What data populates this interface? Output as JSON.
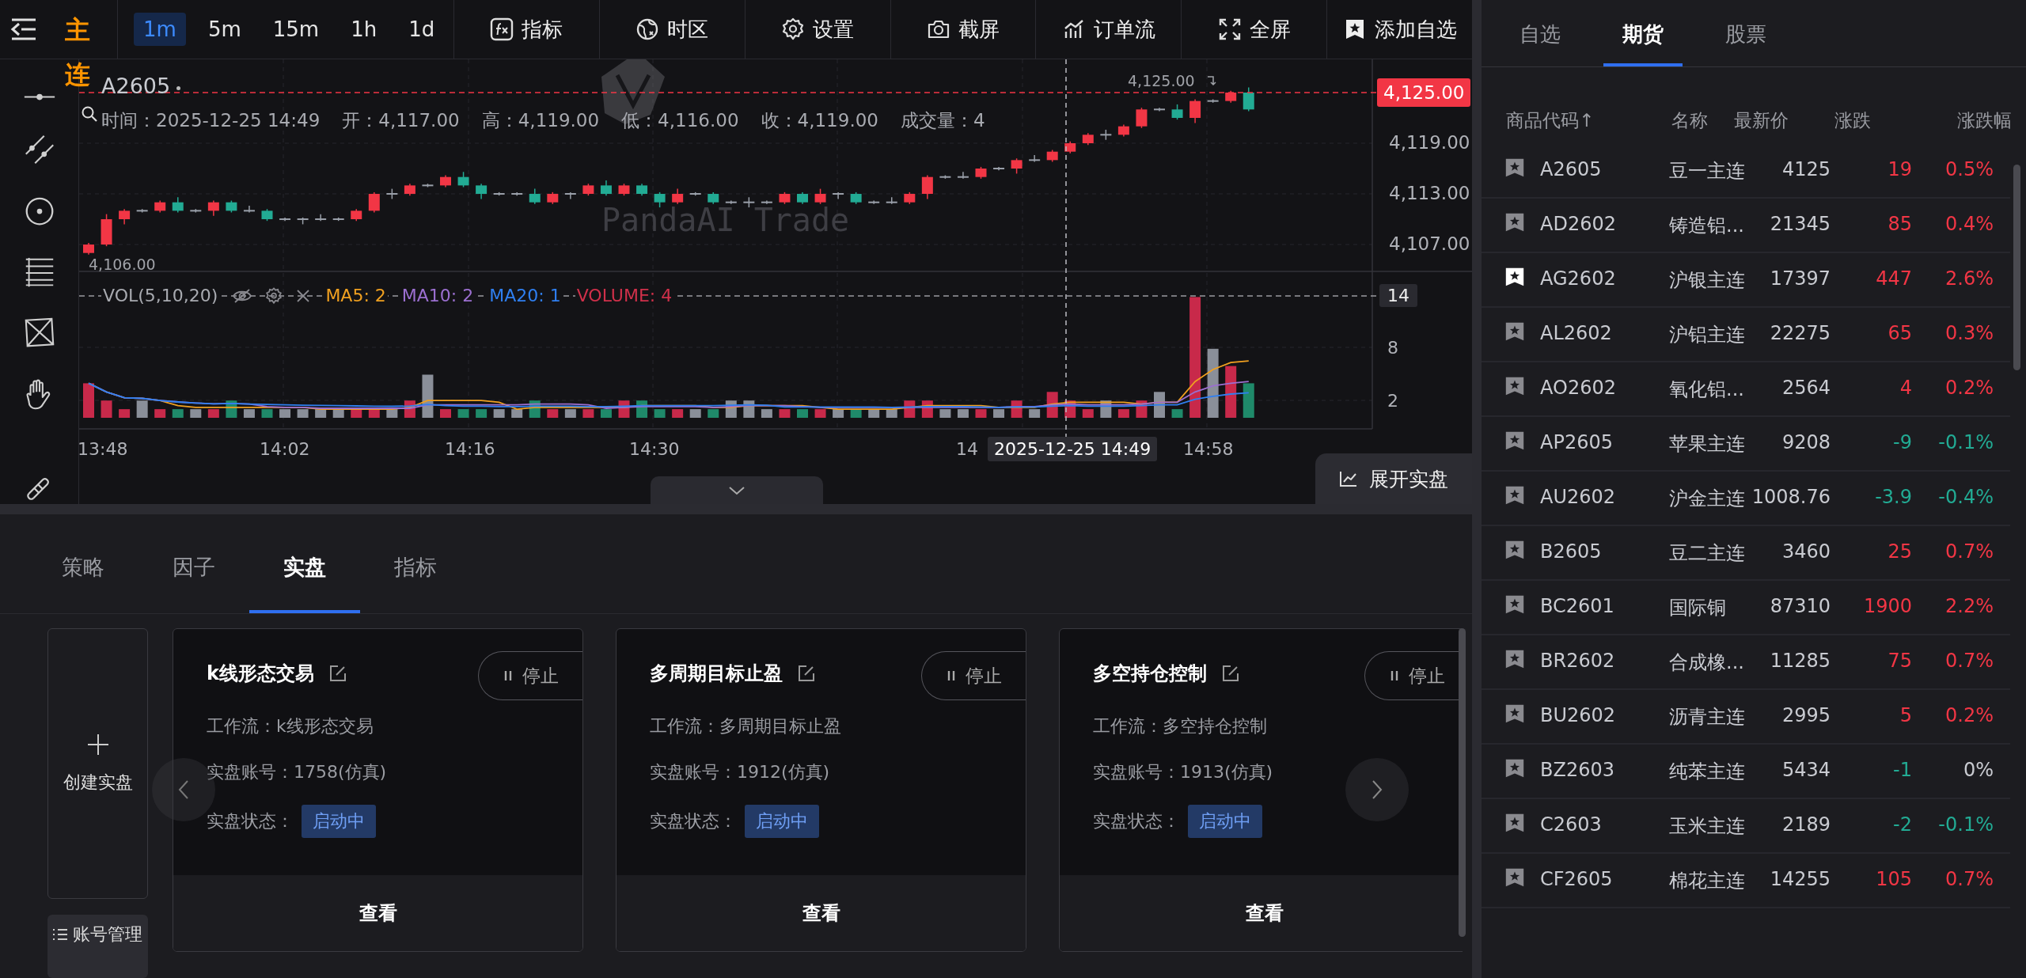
{
  "contract_badge": "主连",
  "intervals": [
    {
      "label": "1m",
      "selected": true
    },
    {
      "label": "5m",
      "selected": false
    },
    {
      "label": "15m",
      "selected": false
    },
    {
      "label": "1h",
      "selected": false
    },
    {
      "label": "1d",
      "selected": false
    }
  ],
  "toolbar_buttons": [
    {
      "label": "指标"
    },
    {
      "label": "时区"
    },
    {
      "label": "设置"
    },
    {
      "label": "截屏"
    },
    {
      "label": "订单流"
    },
    {
      "label": "全屏"
    },
    {
      "label": "添加自选"
    }
  ],
  "chart": {
    "symbol": "A2605",
    "info": [
      "时间：2025-12-25 14:49",
      "开：4,117.00",
      "高：4,119.00",
      "低：4,116.00",
      "收：4,119.00",
      "成交量：4"
    ],
    "price_ticks": [
      "4,119.00",
      "4,113.00",
      "4,107.00"
    ],
    "current_price": "4,125.00",
    "high_mark": "4,125.00",
    "low_mark": "4,106.00",
    "watermark": "PandaAI Trade",
    "volume_title": "VOL(5,10,20)",
    "volume_legend": [
      {
        "text": "MA5: 2",
        "color": "#f0a020"
      },
      {
        "text": "MA10: 2",
        "color": "#9b6fd0"
      },
      {
        "text": "MA20: 1",
        "color": "#2f7ff0"
      },
      {
        "text": "VOLUME: 4",
        "color": "#d0304a"
      }
    ],
    "volume_tag": "14",
    "volume_ticks": [
      "8",
      "2"
    ],
    "time_ticks": [
      "13:48",
      "14:02",
      "14:16",
      "14:30",
      "14",
      "14:58"
    ],
    "crosshair_time": "2025-12-25 14:49"
  },
  "expand_button": "展开实盘",
  "bottom_tabs": [
    {
      "label": "策略",
      "selected": false
    },
    {
      "label": "因子",
      "selected": false
    },
    {
      "label": "实盘",
      "selected": true
    },
    {
      "label": "指标",
      "selected": false
    }
  ],
  "create_card": "创建实盘",
  "account_button": "账号管理",
  "cards": [
    {
      "title": "k线形态交易",
      "stop": "停止",
      "workflow": "工作流：k线形态交易",
      "account": "实盘账号：1758(仿真)",
      "status_label": "实盘状态：",
      "status": "启动中",
      "view": "查看"
    },
    {
      "title": "多周期目标止盈",
      "stop": "停止",
      "workflow": "工作流：多周期目标止盈",
      "account": "实盘账号：1912(仿真)",
      "status_label": "实盘状态：",
      "status": "启动中",
      "view": "查看"
    },
    {
      "title": "多空持仓控制",
      "stop": "停止",
      "workflow": "工作流：多空持仓控制",
      "account": "实盘账号：1913(仿真)",
      "status_label": "实盘状态：",
      "status": "启动中",
      "view": "查看"
    }
  ],
  "side_tabs": [
    {
      "label": "自选",
      "selected": false
    },
    {
      "label": "期货",
      "selected": true
    },
    {
      "label": "股票",
      "selected": false
    }
  ],
  "columns": [
    "商品代码↑",
    "名称",
    "最新价",
    "涨跌",
    "涨跌幅"
  ],
  "rows": [
    {
      "code": "A2605",
      "name": "豆一主连",
      "price": "4125",
      "change": {
        "text": "19",
        "color": "#f23645"
      },
      "pct": {
        "text": "0.5%",
        "color": "#f23645"
      },
      "favorite": false
    },
    {
      "code": "AD2602",
      "name": "铸造铝...",
      "price": "21345",
      "change": {
        "text": "85",
        "color": "#f23645"
      },
      "pct": {
        "text": "0.4%",
        "color": "#f23645"
      },
      "favorite": false
    },
    {
      "code": "AG2602",
      "name": "沪银主连",
      "price": "17397",
      "change": {
        "text": "447",
        "color": "#f23645"
      },
      "pct": {
        "text": "2.6%",
        "color": "#f23645"
      },
      "favorite": true
    },
    {
      "code": "AL2602",
      "name": "沪铝主连",
      "price": "22275",
      "change": {
        "text": "65",
        "color": "#f23645"
      },
      "pct": {
        "text": "0.3%",
        "color": "#f23645"
      },
      "favorite": false
    },
    {
      "code": "AO2602",
      "name": "氧化铝...",
      "price": "2564",
      "change": {
        "text": "4",
        "color": "#f23645"
      },
      "pct": {
        "text": "0.2%",
        "color": "#f23645"
      },
      "favorite": false
    },
    {
      "code": "AP2605",
      "name": "苹果主连",
      "price": "9208",
      "change": {
        "text": "-9",
        "color": "#22ab94"
      },
      "pct": {
        "text": "-0.1%",
        "color": "#22ab94"
      },
      "favorite": false
    },
    {
      "code": "AU2602",
      "name": "沪金主连",
      "price": "1008.76",
      "change": {
        "text": "-3.9",
        "color": "#22ab94"
      },
      "pct": {
        "text": "-0.4%",
        "color": "#22ab94"
      },
      "favorite": false
    },
    {
      "code": "B2605",
      "name": "豆二主连",
      "price": "3460",
      "change": {
        "text": "25",
        "color": "#f23645"
      },
      "pct": {
        "text": "0.7%",
        "color": "#f23645"
      },
      "favorite": false
    },
    {
      "code": "BC2601",
      "name": "国际铜",
      "price": "87310",
      "change": {
        "text": "1900",
        "color": "#f23645"
      },
      "pct": {
        "text": "2.2%",
        "color": "#f23645"
      },
      "favorite": false
    },
    {
      "code": "BR2602",
      "name": "合成橡...",
      "price": "11285",
      "change": {
        "text": "75",
        "color": "#f23645"
      },
      "pct": {
        "text": "0.7%",
        "color": "#f23645"
      },
      "favorite": false
    },
    {
      "code": "BU2602",
      "name": "沥青主连",
      "price": "2995",
      "change": {
        "text": "5",
        "color": "#f23645"
      },
      "pct": {
        "text": "0.2%",
        "color": "#f23645"
      },
      "favorite": false
    },
    {
      "code": "BZ2603",
      "name": "纯苯主连",
      "price": "5434",
      "change": {
        "text": "-1",
        "color": "#22ab94"
      },
      "pct": {
        "text": "0%",
        "color": "#c9cbd1"
      },
      "favorite": false
    },
    {
      "code": "C2603",
      "name": "玉米主连",
      "price": "2189",
      "change": {
        "text": "-2",
        "color": "#22ab94"
      },
      "pct": {
        "text": "-0.1%",
        "color": "#22ab94"
      },
      "favorite": false
    },
    {
      "code": "CF2605",
      "name": "棉花主连",
      "price": "14255",
      "change": {
        "text": "105",
        "color": "#f23645"
      },
      "pct": {
        "text": "0.7%",
        "color": "#f23645"
      },
      "favorite": false
    }
  ]
}
